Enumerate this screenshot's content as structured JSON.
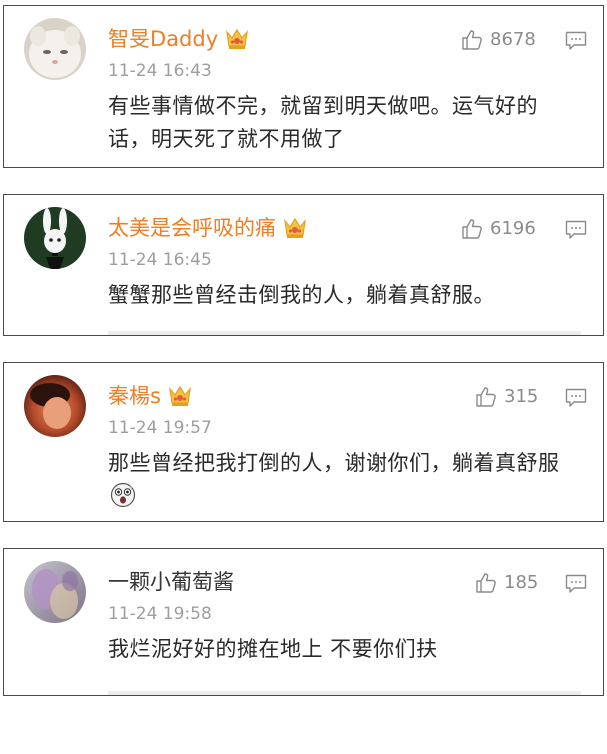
{
  "comments": [
    {
      "username": "智旻Daddy",
      "timestamp": "11-24 16:43",
      "likes": "8678",
      "text": "有些事情做不完，就留到明天做吧。运气好的话，明天死了就不用做了"
    },
    {
      "username": "太美是会呼吸的痛",
      "timestamp": "11-24 16:45",
      "likes": "6196",
      "text": "蟹蟹那些曾经击倒我的人，躺着真舒服。"
    },
    {
      "username": "秦楊s",
      "timestamp": "11-24 19:57",
      "likes": "315",
      "text": "那些曾经把我打倒的人，谢谢你们，躺着真舒服"
    },
    {
      "username": "一颗小葡萄酱",
      "timestamp": "11-24 19:58",
      "likes": "185",
      "text": "我烂泥好好的摊在地上 不要你们扶"
    }
  ],
  "colors": {
    "vip_username": "#ef7e25",
    "username_plain": "#333333",
    "timestamp": "#9e9e9e",
    "like_count": "#8b8b8b",
    "border": "#4a4a4a"
  },
  "icons": [
    "thumbs-up-icon",
    "comment-icon",
    "vip-crown-icon",
    "surprised-emoji-icon"
  ]
}
